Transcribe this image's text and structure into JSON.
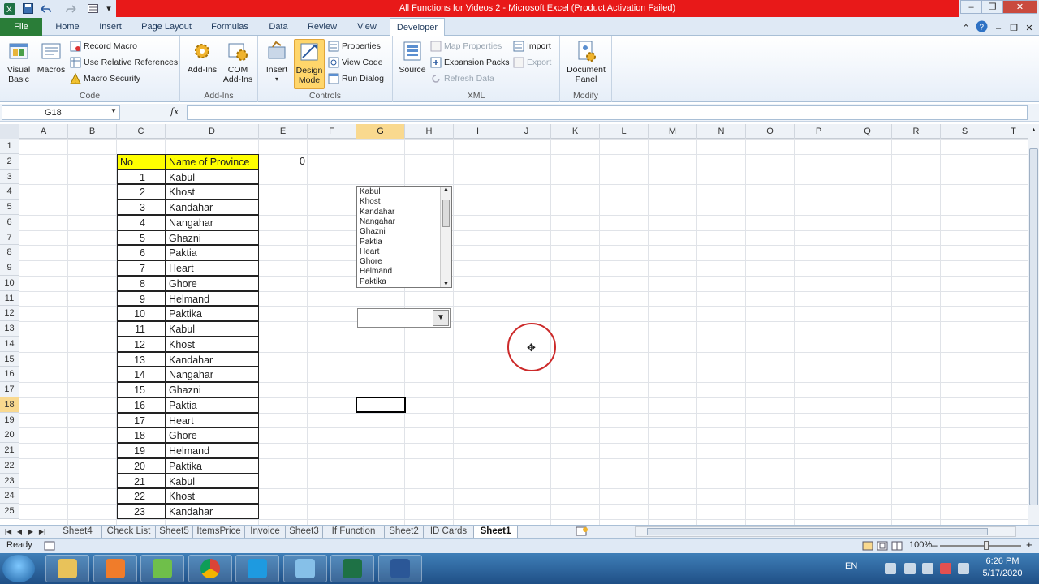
{
  "window": {
    "title": "All Functions for Videos 2  -  Microsoft Excel (Product Activation Failed)",
    "controls": [
      "–",
      "❐",
      "✕"
    ]
  },
  "ribbon": {
    "tabs": [
      "File",
      "Home",
      "Insert",
      "Page Layout",
      "Formulas",
      "Data",
      "Review",
      "View",
      "Developer"
    ],
    "active_tab": "Developer",
    "groups": {
      "code": {
        "label": "Code",
        "visual_basic": "Visual Basic",
        "macros": "Macros",
        "record_macro": "Record Macro",
        "use_relative": "Use Relative References",
        "macro_security": "Macro Security"
      },
      "addins": {
        "label": "Add-Ins",
        "addins": "Add-Ins",
        "com_addins": "COM Add-Ins"
      },
      "controls": {
        "label": "Controls",
        "insert": "Insert",
        "design_mode": "Design Mode",
        "properties": "Properties",
        "view_code": "View Code",
        "run_dialog": "Run Dialog"
      },
      "xml": {
        "label": "XML",
        "source": "Source",
        "map_properties": "Map Properties",
        "expansion_packs": "Expansion Packs",
        "refresh_data": "Refresh Data",
        "import": "Import",
        "export": "Export"
      },
      "modify": {
        "label": "Modify",
        "document_panel": "Document Panel"
      }
    }
  },
  "formula_bar": {
    "name_box": "G18",
    "fx": "fx",
    "formula": ""
  },
  "grid": {
    "columns": [
      "A",
      "B",
      "C",
      "D",
      "E",
      "F",
      "G",
      "H",
      "I",
      "J",
      "K",
      "L",
      "M",
      "N",
      "O",
      "P",
      "Q",
      "R",
      "S",
      "T"
    ],
    "selected_column": "G",
    "rows": [
      "1",
      "2",
      "3",
      "4",
      "5",
      "6",
      "7",
      "8",
      "9",
      "10",
      "11",
      "12",
      "13",
      "14",
      "15",
      "16",
      "17",
      "18",
      "19",
      "20",
      "21",
      "22",
      "23",
      "24",
      "25"
    ],
    "selected_row": "18",
    "header_no": "No",
    "header_name": "Name of Province",
    "e2_value": "0",
    "table": [
      [
        "1",
        "Kabul"
      ],
      [
        "2",
        "Khost"
      ],
      [
        "3",
        "Kandahar"
      ],
      [
        "4",
        "Nangahar"
      ],
      [
        "5",
        "Ghazni"
      ],
      [
        "6",
        "Paktia"
      ],
      [
        "7",
        "Heart"
      ],
      [
        "8",
        "Ghore"
      ],
      [
        "9",
        "Helmand"
      ],
      [
        "10",
        "Paktika"
      ],
      [
        "11",
        "Kabul"
      ],
      [
        "12",
        "Khost"
      ],
      [
        "13",
        "Kandahar"
      ],
      [
        "14",
        "Nangahar"
      ],
      [
        "15",
        "Ghazni"
      ],
      [
        "16",
        "Paktia"
      ],
      [
        "17",
        "Heart"
      ],
      [
        "18",
        "Ghore"
      ],
      [
        "19",
        "Helmand"
      ],
      [
        "20",
        "Paktika"
      ],
      [
        "21",
        "Kabul"
      ],
      [
        "22",
        "Khost"
      ],
      [
        "23",
        "Kandahar"
      ]
    ]
  },
  "listbox": {
    "items": [
      "Kabul",
      "Khost",
      "Kandahar",
      "Nangahar",
      "Ghazni",
      "Paktia",
      "Heart",
      "Ghore",
      "Helmand",
      "Paktika"
    ]
  },
  "combobox": {
    "value": ""
  },
  "sheets": {
    "tabs": [
      "Sheet4",
      "Check List",
      "Sheet5",
      "ItemsPrice",
      "Invoice",
      "Sheet3",
      "If Function",
      "Sheet2",
      "ID Cards",
      "Sheet1"
    ],
    "active": "Sheet1"
  },
  "status": {
    "text": "Ready",
    "zoom": "100%"
  },
  "taskbar": {
    "lang": "EN",
    "time": "6:26 PM",
    "date": "5/17/2020",
    "apps": [
      "file-explorer-icon",
      "media-player-icon",
      "app-green-icon",
      "chrome-icon",
      "skype-icon",
      "app-blue-icon",
      "excel-icon",
      "word-icon"
    ]
  },
  "colors": {
    "title_bar": "#e81919",
    "file_tab": "#2a7d38",
    "header_fill": "#ffff00",
    "selection_header": "#f9d98f",
    "cursor_ring": "#cc2a2a"
  }
}
